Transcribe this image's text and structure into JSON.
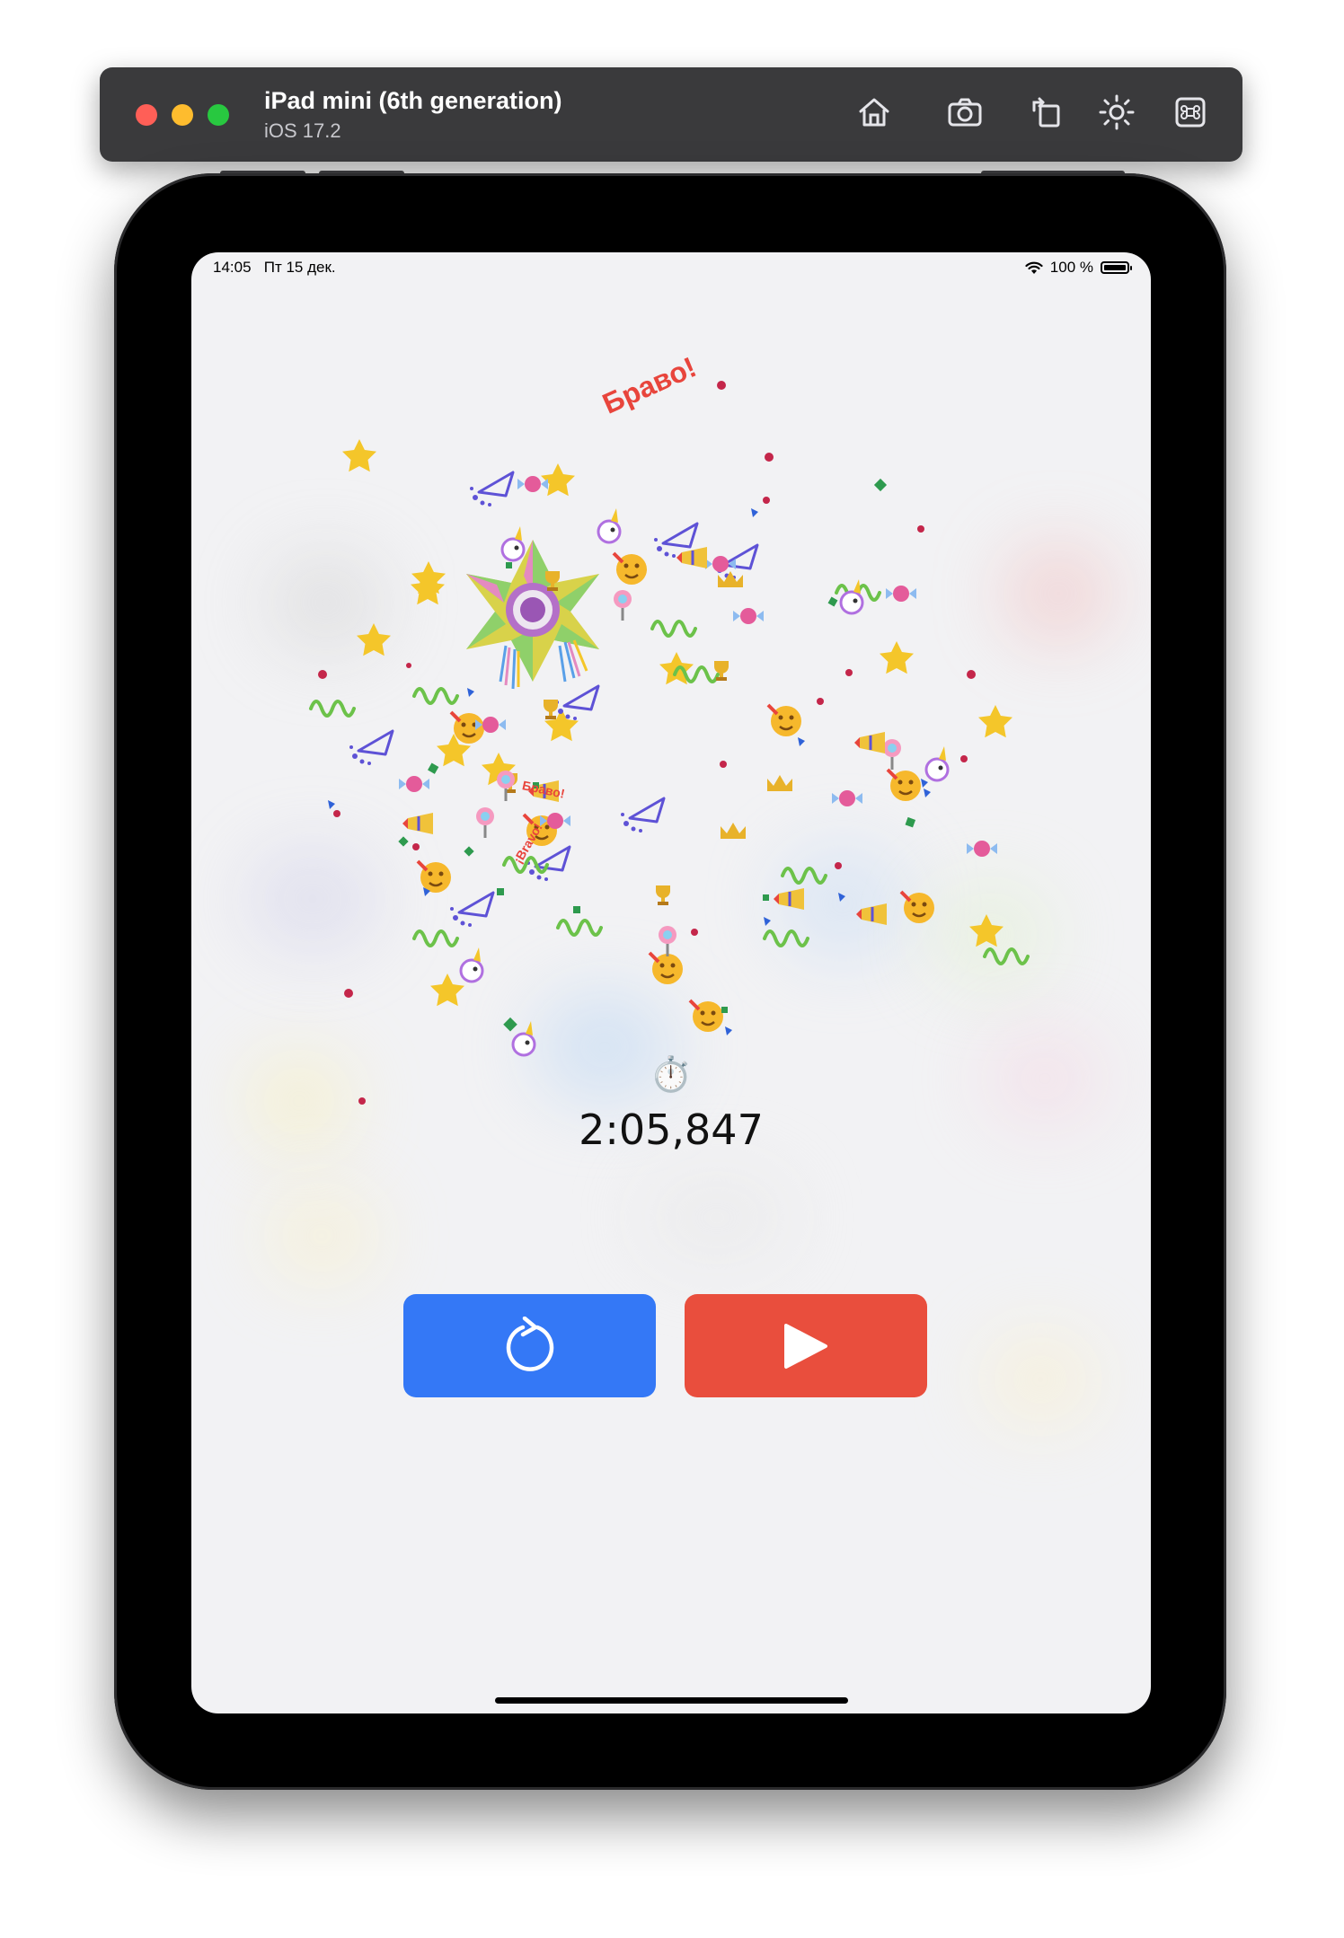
{
  "simulator": {
    "device_name": "iPad mini (6th generation)",
    "os_version": "iOS 17.2",
    "toolbar_icons": [
      "home-icon",
      "screenshot-icon",
      "rotate-icon",
      "appearance-icon",
      "command-icon"
    ]
  },
  "status_bar": {
    "time": "14:05",
    "date": "Пт 15 дек.",
    "battery_text": "100 %",
    "icons": [
      "wifi-icon",
      "battery-icon"
    ]
  },
  "celebration": {
    "headline": "Браво!",
    "small_labels": [
      "Браво!",
      "¡Bravo!"
    ],
    "centerpiece": "piñata-star"
  },
  "timer": {
    "icon": "⏱️",
    "elapsed": "2:05,847"
  },
  "controls": {
    "reset_icon": "reset-icon",
    "play_icon": "play-icon",
    "colors": {
      "reset": "#3478f6",
      "play": "#e94e3d"
    }
  }
}
